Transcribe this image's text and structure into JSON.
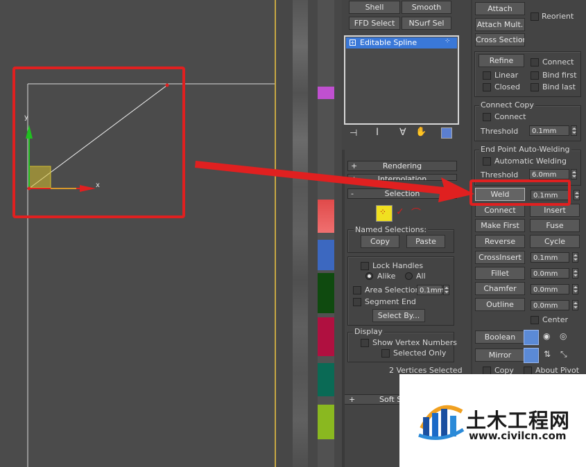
{
  "viewport": {
    "x_axis_label": "x",
    "y_axis_label": "y"
  },
  "panel_a": {
    "top_buttons": [
      "Shell",
      "Smooth",
      "FFD Select",
      "NSurf Sel"
    ],
    "stack_item": "Editable Spline",
    "rollouts": {
      "rendering": "Rendering",
      "interpolation": "Interpolation",
      "selection": "Selection",
      "soft_selection": "Soft Se"
    },
    "named_selections": {
      "title": "Named Selections:",
      "copy": "Copy",
      "paste": "Paste"
    },
    "lock_handles": "Lock Handles",
    "alike": "Alike",
    "all": "All",
    "area_selection": {
      "label": "Area Selection:",
      "value": "0.1mm"
    },
    "segment_end": "Segment End",
    "select_by": "Select By...",
    "display": {
      "title": "Display",
      "show_vertex_numbers": "Show Vertex Numbers",
      "selected_only": "Selected Only"
    },
    "status": "2 Vertices Selected"
  },
  "panel_b": {
    "attach": "Attach",
    "reorient": "Reorient",
    "attach_mult": "Attach Mult.",
    "cross_section": "Cross Section",
    "refine": "Refine",
    "connect_cb": "Connect",
    "linear": "Linear",
    "bind_first": "Bind first",
    "closed": "Closed",
    "bind_last": "Bind last",
    "connect_copy": {
      "title": "Connect Copy",
      "connect": "Connect",
      "threshold_label": "Threshold",
      "threshold_value": "0.1mm"
    },
    "end_point": {
      "title": "End Point Auto-Welding",
      "automatic_welding": "Automatic Welding",
      "threshold_label": "Threshold",
      "threshold_value": "6.0mm"
    },
    "weld": {
      "label": "Weld",
      "value": "0.1mm"
    },
    "connect": "Connect",
    "insert": "Insert",
    "make_first": "Make First",
    "fuse": "Fuse",
    "reverse": "Reverse",
    "cycle": "Cycle",
    "cross_insert": {
      "label": "CrossInsert",
      "value": "0.1mm"
    },
    "fillet": {
      "label": "Fillet",
      "value": "0.0mm"
    },
    "chamfer": {
      "label": "Chamfer",
      "value": "0.0mm"
    },
    "outline": {
      "label": "Outline",
      "value": "0.0mm"
    },
    "center": "Center",
    "boolean": "Boolean",
    "mirror": "Mirror",
    "copy": "Copy",
    "about_pivot": "About Pivot"
  },
  "watermark": {
    "cn_text": "土木工程网",
    "url": "www.civilcn.com"
  },
  "colors": {
    "annotation_red": "#e02020",
    "selection_blue": "#3a78d8",
    "gizmo_green": "#20c020",
    "gizmo_red": "#e02020",
    "gizmo_yellow": "#d6c030"
  }
}
